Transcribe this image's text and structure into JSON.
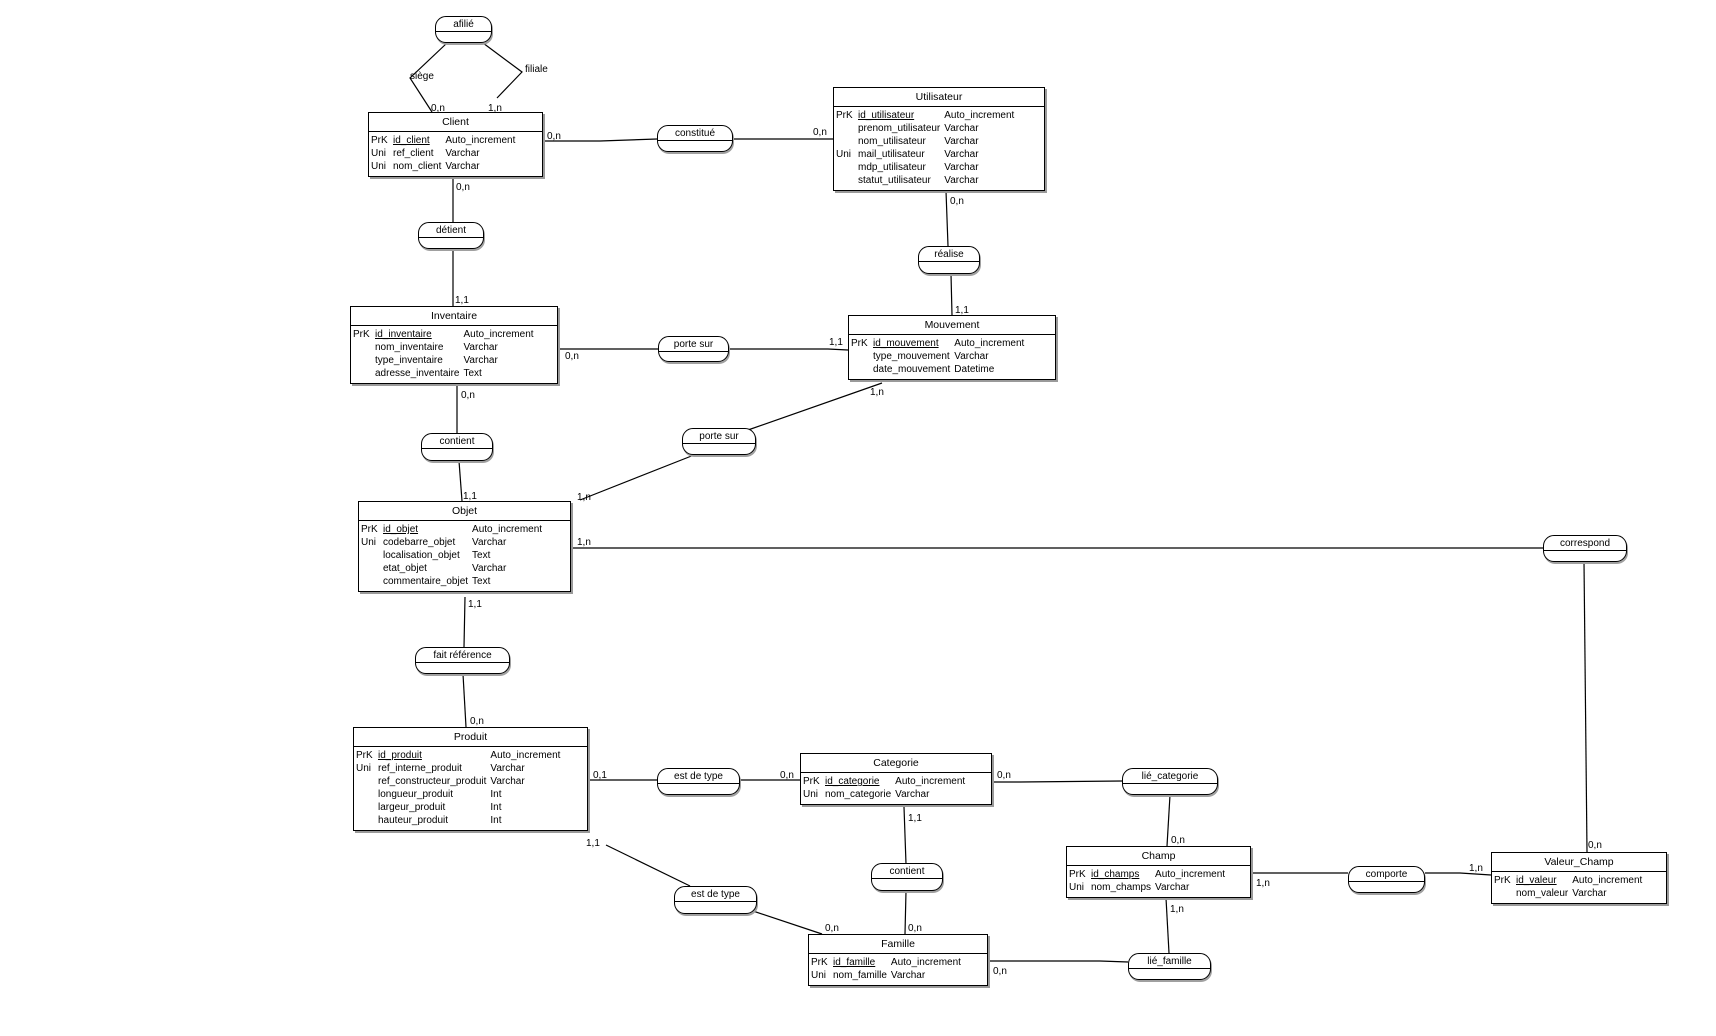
{
  "diagram": {
    "type": "MCD (conceptual data model)",
    "entities": [
      {
        "id": "client",
        "name": "Client",
        "attributes": [
          {
            "key": "PrK",
            "name": "id_client",
            "type": "Auto_increment",
            "primary": true
          },
          {
            "key": "Uni",
            "name": "ref_client",
            "type": "Varchar"
          },
          {
            "key": "Uni",
            "name": "nom_client",
            "type": "Varchar"
          }
        ]
      },
      {
        "id": "utilisateur",
        "name": "Utilisateur",
        "attributes": [
          {
            "key": "PrK",
            "name": "id_utilisateur",
            "type": "Auto_increment",
            "primary": true
          },
          {
            "key": "",
            "name": "prenom_utilisateur",
            "type": "Varchar"
          },
          {
            "key": "",
            "name": "nom_utilisateur",
            "type": "Varchar"
          },
          {
            "key": "Uni",
            "name": "mail_utilisateur",
            "type": "Varchar"
          },
          {
            "key": "",
            "name": "mdp_utilisateur",
            "type": "Varchar"
          },
          {
            "key": "",
            "name": "statut_utilisateur",
            "type": "Varchar"
          }
        ]
      },
      {
        "id": "inventaire",
        "name": "Inventaire",
        "attributes": [
          {
            "key": "PrK",
            "name": "id_inventaire",
            "type": "Auto_increment",
            "primary": true
          },
          {
            "key": "",
            "name": "nom_inventaire",
            "type": "Varchar"
          },
          {
            "key": "",
            "name": "type_inventaire",
            "type": "Varchar"
          },
          {
            "key": "",
            "name": "adresse_inventaire",
            "type": "Text"
          }
        ]
      },
      {
        "id": "mouvement",
        "name": "Mouvement",
        "attributes": [
          {
            "key": "PrK",
            "name": "id_mouvement",
            "type": "Auto_increment",
            "primary": true
          },
          {
            "key": "",
            "name": "type_mouvement",
            "type": "Varchar"
          },
          {
            "key": "",
            "name": "date_mouvement",
            "type": "Datetime"
          }
        ]
      },
      {
        "id": "objet",
        "name": "Objet",
        "attributes": [
          {
            "key": "PrK",
            "name": "id_objet",
            "type": "Auto_increment",
            "primary": true
          },
          {
            "key": "Uni",
            "name": "codebarre_objet",
            "type": "Varchar"
          },
          {
            "key": "",
            "name": "localisation_objet",
            "type": "Text"
          },
          {
            "key": "",
            "name": "etat_objet",
            "type": "Varchar"
          },
          {
            "key": "",
            "name": "commentaire_objet",
            "type": "Text"
          }
        ]
      },
      {
        "id": "produit",
        "name": "Produit",
        "attributes": [
          {
            "key": "PrK",
            "name": "id_produit",
            "type": "Auto_increment",
            "primary": true
          },
          {
            "key": "Uni",
            "name": "ref_interne_produit",
            "type": "Varchar"
          },
          {
            "key": "",
            "name": "ref_constructeur_produit",
            "type": "Varchar"
          },
          {
            "key": "",
            "name": "longueur_produit",
            "type": "Int"
          },
          {
            "key": "",
            "name": "largeur_produit",
            "type": "Int"
          },
          {
            "key": "",
            "name": "hauteur_produit",
            "type": "Int"
          }
        ]
      },
      {
        "id": "categorie",
        "name": "Categorie",
        "attributes": [
          {
            "key": "PrK",
            "name": "id_categorie",
            "type": "Auto_increment",
            "primary": true
          },
          {
            "key": "Uni",
            "name": "nom_categorie",
            "type": "Varchar"
          }
        ]
      },
      {
        "id": "champ",
        "name": "Champ",
        "attributes": [
          {
            "key": "PrK",
            "name": "id_champs",
            "type": "Auto_increment",
            "primary": true
          },
          {
            "key": "Uni",
            "name": "nom_champs",
            "type": "Varchar"
          }
        ]
      },
      {
        "id": "valeur_champ",
        "name": "Valeur_Champ",
        "attributes": [
          {
            "key": "PrK",
            "name": "id_valeur",
            "type": "Auto_increment",
            "primary": true
          },
          {
            "key": "",
            "name": "nom_valeur",
            "type": "Varchar"
          }
        ]
      },
      {
        "id": "famille",
        "name": "Famille",
        "attributes": [
          {
            "key": "PrK",
            "name": "id_famille",
            "type": "Auto_increment",
            "primary": true
          },
          {
            "key": "Uni",
            "name": "nom_famille",
            "type": "Varchar"
          }
        ]
      }
    ],
    "relationships": [
      {
        "id": "afilie",
        "name": "afilié"
      },
      {
        "id": "constitue",
        "name": "constitué"
      },
      {
        "id": "detient",
        "name": "détient"
      },
      {
        "id": "realise",
        "name": "réalise"
      },
      {
        "id": "porte_sur_1",
        "name": "porte sur"
      },
      {
        "id": "contient_1",
        "name": "contient"
      },
      {
        "id": "porte_sur_2",
        "name": "porte sur"
      },
      {
        "id": "correspond",
        "name": "correspond"
      },
      {
        "id": "fait_reference",
        "name": "fait référence"
      },
      {
        "id": "est_de_type_1",
        "name": "est de type"
      },
      {
        "id": "lie_categorie",
        "name": "lié_categorie"
      },
      {
        "id": "est_de_type_2",
        "name": "est de type"
      },
      {
        "id": "contient_2",
        "name": "contient"
      },
      {
        "id": "comporte",
        "name": "comporte"
      },
      {
        "id": "lie_famille",
        "name": "lié_famille"
      }
    ],
    "roles": {
      "siege": "siège",
      "filiale": "filiale"
    },
    "cardinalities": {
      "afilie_siege_client": "0,n",
      "afilie_filiale_client": "1,n",
      "constitue_client": "0,n",
      "constitue_utilisateur": "0,n",
      "detient_client": "0,n",
      "detient_inventaire": "1,1",
      "realise_utilisateur": "0,n",
      "realise_mouvement": "1,1",
      "porte_sur_1_inventaire": "0,n",
      "porte_sur_1_mouvement": "1,1",
      "contient_1_inventaire": "0,n",
      "contient_1_objet": "1,1",
      "porte_sur_2_mouvement": "1,n",
      "porte_sur_2_objet": "1,n",
      "correspond_objet": "1,n",
      "correspond_valeur": "0,n",
      "fait_reference_objet": "1,1",
      "fait_reference_produit": "0,n",
      "est_de_type_1_produit": "0,1",
      "est_de_type_1_categorie": "0,n",
      "lie_categorie_categorie": "0,n",
      "lie_categorie_champ": "0,n",
      "est_de_type_2_produit": "1,1",
      "est_de_type_2_famille": "0,n",
      "contient_2_categorie": "1,1",
      "contient_2_famille": "0,n",
      "comporte_champ": "1,n",
      "comporte_valeur": "1,n",
      "lie_famille_champ": "1,n",
      "lie_famille_famille": "0,n"
    }
  }
}
